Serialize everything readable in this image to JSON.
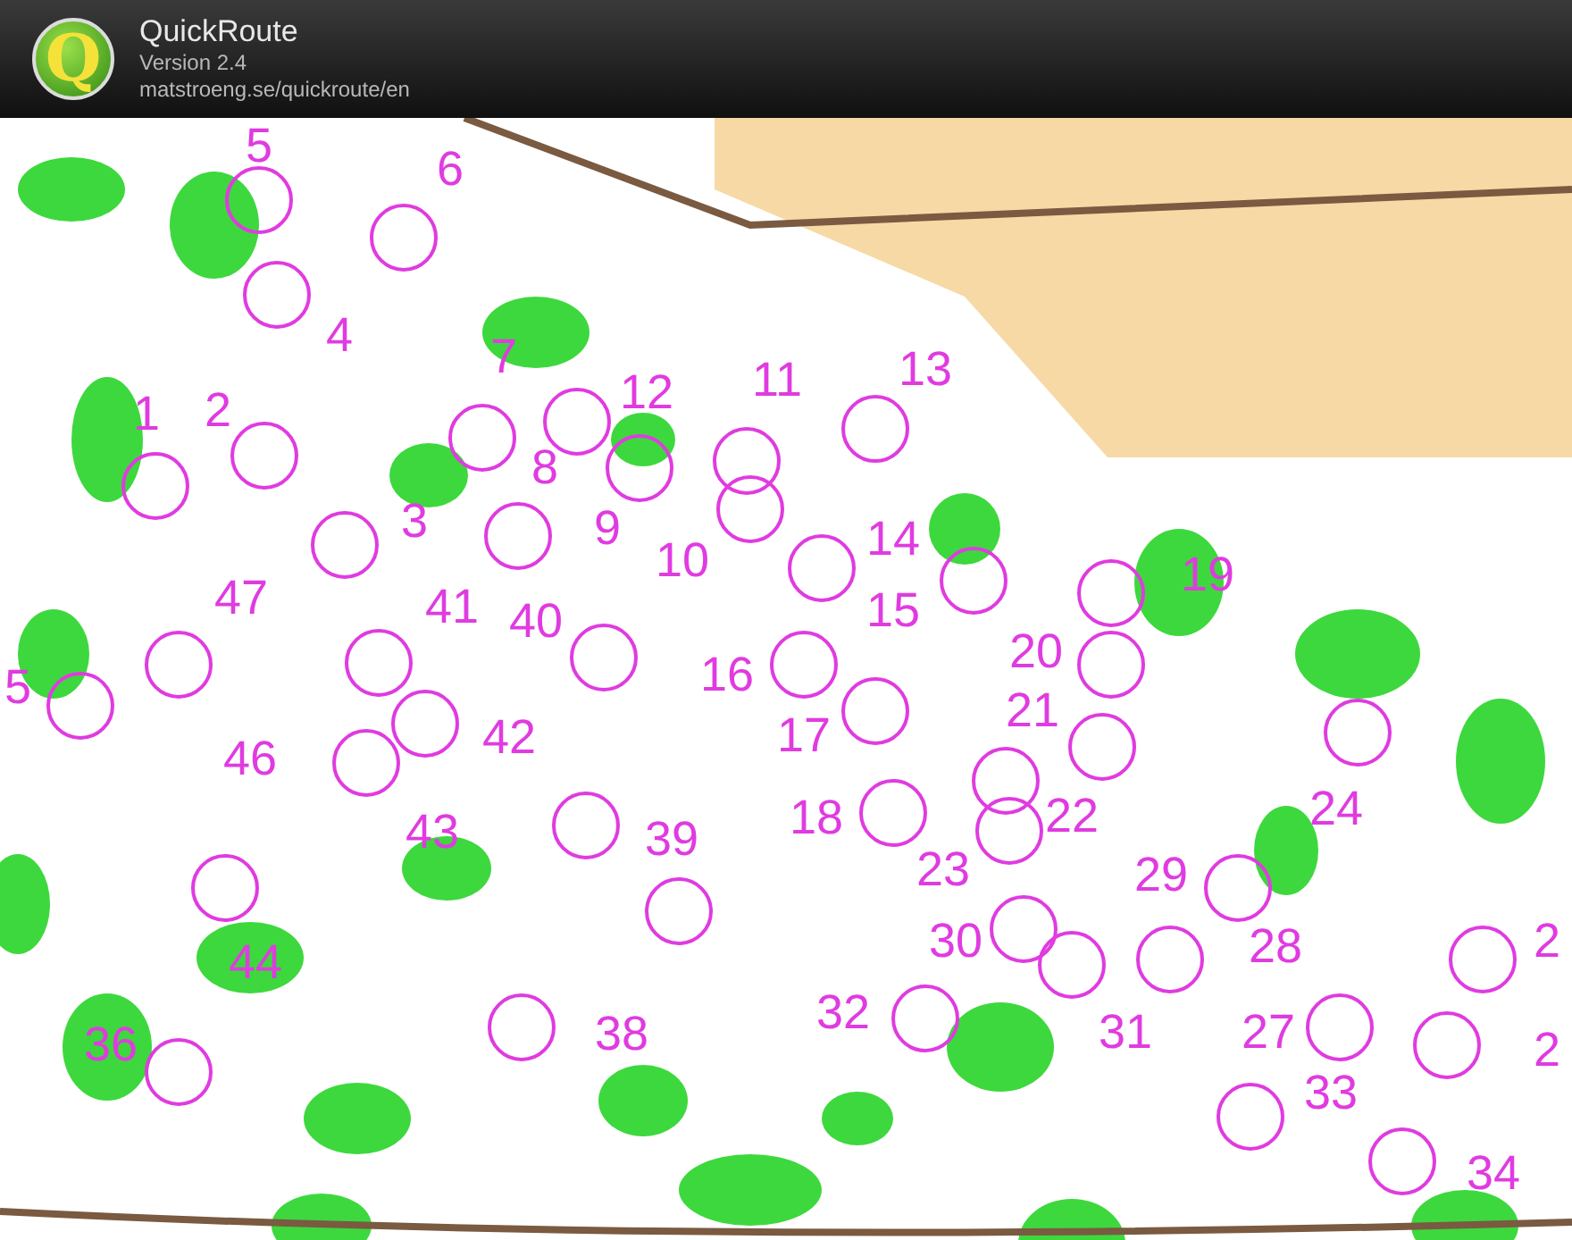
{
  "app": {
    "name": "QuickRoute",
    "version": "Version 2.4",
    "url": "matstroeng.se/quickroute/en",
    "logo_letter": "Q"
  },
  "map": {
    "controls": [
      {
        "label": "5"
      },
      {
        "label": "6"
      },
      {
        "label": "4"
      },
      {
        "label": "7"
      },
      {
        "label": "1"
      },
      {
        "label": "2"
      },
      {
        "label": "12"
      },
      {
        "label": "11"
      },
      {
        "label": "13"
      },
      {
        "label": "8"
      },
      {
        "label": "3"
      },
      {
        "label": "9"
      },
      {
        "label": "10"
      },
      {
        "label": "14"
      },
      {
        "label": "19"
      },
      {
        "label": "47"
      },
      {
        "label": "41"
      },
      {
        "label": "40"
      },
      {
        "label": "15"
      },
      {
        "label": "5"
      },
      {
        "label": "16"
      },
      {
        "label": "20"
      },
      {
        "label": "46"
      },
      {
        "label": "42"
      },
      {
        "label": "17"
      },
      {
        "label": "21"
      },
      {
        "label": "43"
      },
      {
        "label": "39"
      },
      {
        "label": "18"
      },
      {
        "label": "22"
      },
      {
        "label": "24"
      },
      {
        "label": "23"
      },
      {
        "label": "29"
      },
      {
        "label": "44"
      },
      {
        "label": "30"
      },
      {
        "label": "28"
      },
      {
        "label": "2"
      },
      {
        "label": "36"
      },
      {
        "label": "38"
      },
      {
        "label": "32"
      },
      {
        "label": "31"
      },
      {
        "label": "27"
      },
      {
        "label": "2"
      },
      {
        "label": "33"
      },
      {
        "label": "34"
      }
    ]
  }
}
